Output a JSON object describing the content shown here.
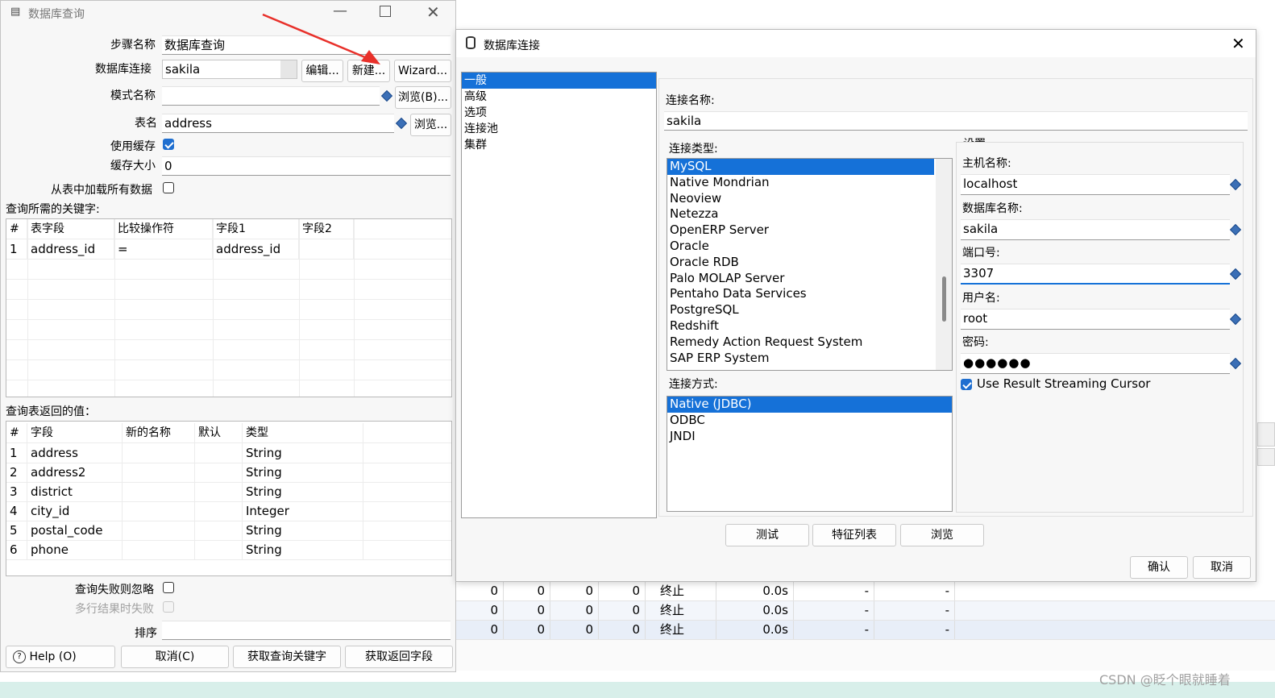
{
  "left_window": {
    "title": "数据库查询",
    "step_name_label": "步骤名称",
    "step_name_value": "数据库查询",
    "connection_label": "数据库连接",
    "connection_value": "sakila",
    "edit_button": "编辑...",
    "new_button": "新建...",
    "wizard_button": "Wizard...",
    "schema_label": "模式名称",
    "schema_value": "",
    "browse_b_button": "浏览(B)...",
    "table_label": "表名",
    "table_value": "address",
    "browse_button": "浏览...",
    "use_cache_label": "使用缓存",
    "use_cache_checked": true,
    "cache_size_label": "缓存大小",
    "cache_size_value": "0",
    "load_all_label": "从表中加载所有数据",
    "keys_section_label": "查询所需的关键字:",
    "keys_table": {
      "headers": [
        "#",
        "表字段",
        "比较操作符",
        "字段1",
        "字段2"
      ],
      "rows": [
        [
          "1",
          "address_id",
          "=",
          "address_id",
          ""
        ]
      ]
    },
    "return_section_label": "查询表返回的值：",
    "return_table": {
      "headers": [
        "#",
        "字段",
        "新的名称",
        "默认",
        "类型"
      ],
      "rows": [
        [
          "1",
          "address",
          "",
          "",
          "String"
        ],
        [
          "2",
          "address2",
          "",
          "",
          "String"
        ],
        [
          "3",
          "district",
          "",
          "",
          "String"
        ],
        [
          "4",
          "city_id",
          "",
          "",
          "Integer"
        ],
        [
          "5",
          "postal_code",
          "",
          "",
          "String"
        ],
        [
          "6",
          "phone",
          "",
          "",
          "String"
        ]
      ]
    },
    "ignore_fail_label": "查询失败则忽略",
    "multi_fail_label": "多行结果时失败",
    "order_label": "排序",
    "order_value": "",
    "help_button": "Help",
    "ok_button": "(O)",
    "cancel_button": "取消(C)",
    "get_keys_button": "获取查询关键字",
    "get_return_button": "获取返回字段"
  },
  "right_dialog": {
    "title": "数据库连接",
    "nav_items": [
      "一般",
      "高级",
      "选项",
      "连接池",
      "集群"
    ],
    "nav_selected": 0,
    "connection_name_label": "连接名称:",
    "connection_name_value": "sakila",
    "connection_type_label": "连接类型:",
    "connection_types": [
      "MySQL",
      "Native Mondrian",
      "Neoview",
      "Netezza",
      "OpenERP Server",
      "Oracle",
      "Oracle RDB",
      "Palo MOLAP Server",
      "Pentaho Data Services",
      "PostgreSQL",
      "Redshift",
      "Remedy Action Request System",
      "SAP ERP System"
    ],
    "connection_type_selected": 0,
    "access_label": "连接方式:",
    "access_methods": [
      "Native (JDBC)",
      "ODBC",
      "JNDI"
    ],
    "access_selected": 0,
    "settings_label": "设置",
    "host_label": "主机名称:",
    "host_value": "localhost",
    "db_label": "数据库名称:",
    "db_value": "sakila",
    "port_label": "端口号:",
    "port_value": "3307",
    "user_label": "用户名:",
    "user_value": "root",
    "password_label": "密码:",
    "password_value": "●●●●●●",
    "streaming_label": "Use Result Streaming Cursor",
    "streaming_checked": true,
    "test_button": "测试",
    "features_button": "特征列表",
    "browse_button": "浏览",
    "ok_button": "确认",
    "cancel_button": "取消"
  },
  "background_grid": {
    "rows": [
      [
        "0",
        "0",
        "0",
        "0",
        "终止",
        "0.0s",
        "-",
        "-"
      ],
      [
        "0",
        "0",
        "0",
        "0",
        "终止",
        "0.0s",
        "-",
        "-"
      ],
      [
        "0",
        "0",
        "0",
        "0",
        "终止",
        "0.0s",
        "-",
        "-"
      ]
    ]
  },
  "watermark": "CSDN @眨个眼就睡着",
  "colors": {
    "selection": "#1571d8",
    "arrow": "#e8302a",
    "checkbox": "#1f6fd0"
  }
}
